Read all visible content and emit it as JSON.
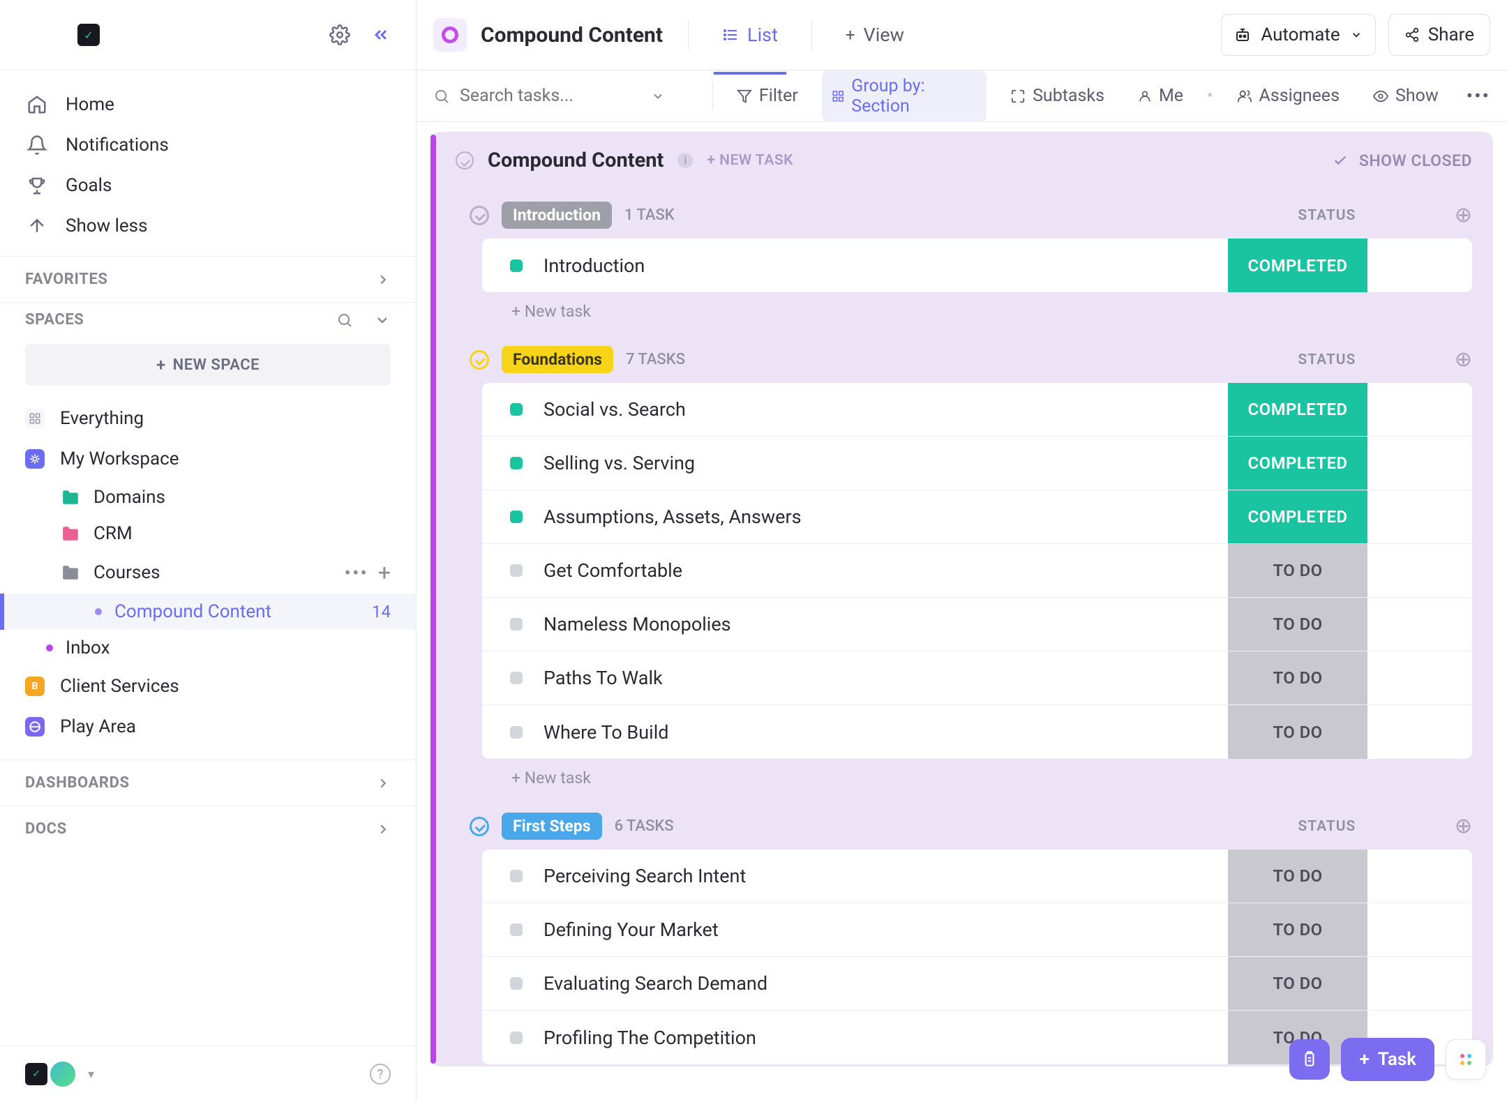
{
  "sidebar": {
    "nav": [
      {
        "icon": "home",
        "label": "Home"
      },
      {
        "icon": "bell",
        "label": "Notifications"
      },
      {
        "icon": "trophy",
        "label": "Goals"
      },
      {
        "icon": "arrow-up",
        "label": "Show less"
      }
    ],
    "favorites_label": "FAVORITES",
    "spaces_label": "SPACES",
    "new_space_label": "NEW SPACE",
    "everything_label": "Everything",
    "workspace_label": "My Workspace",
    "tree": {
      "domains": "Domains",
      "crm": "CRM",
      "courses": "Courses",
      "compound": "Compound Content",
      "compound_count": "14",
      "inbox": "Inbox"
    },
    "client_services": "Client Services",
    "play_area": "Play Area",
    "dashboards_label": "DASHBOARDS",
    "docs_label": "DOCS"
  },
  "topbar": {
    "title": "Compound Content",
    "tab_list": "List",
    "tab_view": "View",
    "automate": "Automate",
    "share": "Share"
  },
  "filterbar": {
    "search_placeholder": "Search tasks...",
    "filter": "Filter",
    "group_by": "Group by: Section",
    "subtasks": "Subtasks",
    "me": "Me",
    "assignees": "Assignees",
    "show": "Show"
  },
  "panel": {
    "title": "Compound Content",
    "new_task": "+ NEW TASK",
    "show_closed": "SHOW CLOSED"
  },
  "sections": [
    {
      "id": "introduction",
      "pill": "Introduction",
      "pill_bg": "#9f9faa",
      "pill_fg": "#ffffff",
      "toggle_color": "#b8aecd",
      "count": "1 TASK",
      "status_header": "STATUS",
      "tasks": [
        {
          "name": "Introduction",
          "status": "COMPLETED"
        }
      ],
      "new_task": "+ New task"
    },
    {
      "id": "foundations",
      "pill": "Foundations",
      "pill_bg": "#f7d417",
      "pill_fg": "#3b3720",
      "toggle_color": "#f7d417",
      "count": "7 TASKS",
      "status_header": "STATUS",
      "tasks": [
        {
          "name": "Social vs. Search",
          "status": "COMPLETED"
        },
        {
          "name": "Selling vs. Serving",
          "status": "COMPLETED"
        },
        {
          "name": "Assumptions, Assets, Answers",
          "status": "COMPLETED"
        },
        {
          "name": "Get Comfortable",
          "status": "TO DO"
        },
        {
          "name": "Nameless Monopolies",
          "status": "TO DO"
        },
        {
          "name": "Paths To Walk",
          "status": "TO DO"
        },
        {
          "name": "Where To Build",
          "status": "TO DO"
        }
      ],
      "new_task": "+ New task"
    },
    {
      "id": "first-steps",
      "pill": "First Steps",
      "pill_bg": "#4aa8ea",
      "pill_fg": "#ffffff",
      "toggle_color": "#4aa8ea",
      "count": "6 TASKS",
      "status_header": "STATUS",
      "tasks": [
        {
          "name": "Perceiving Search Intent",
          "status": "TO DO"
        },
        {
          "name": "Defining Your Market",
          "status": "TO DO"
        },
        {
          "name": "Evaluating Search Demand",
          "status": "TO DO"
        },
        {
          "name": "Profiling The Competition",
          "status": "TO DO"
        }
      ]
    }
  ],
  "float": {
    "task_label": "Task"
  }
}
